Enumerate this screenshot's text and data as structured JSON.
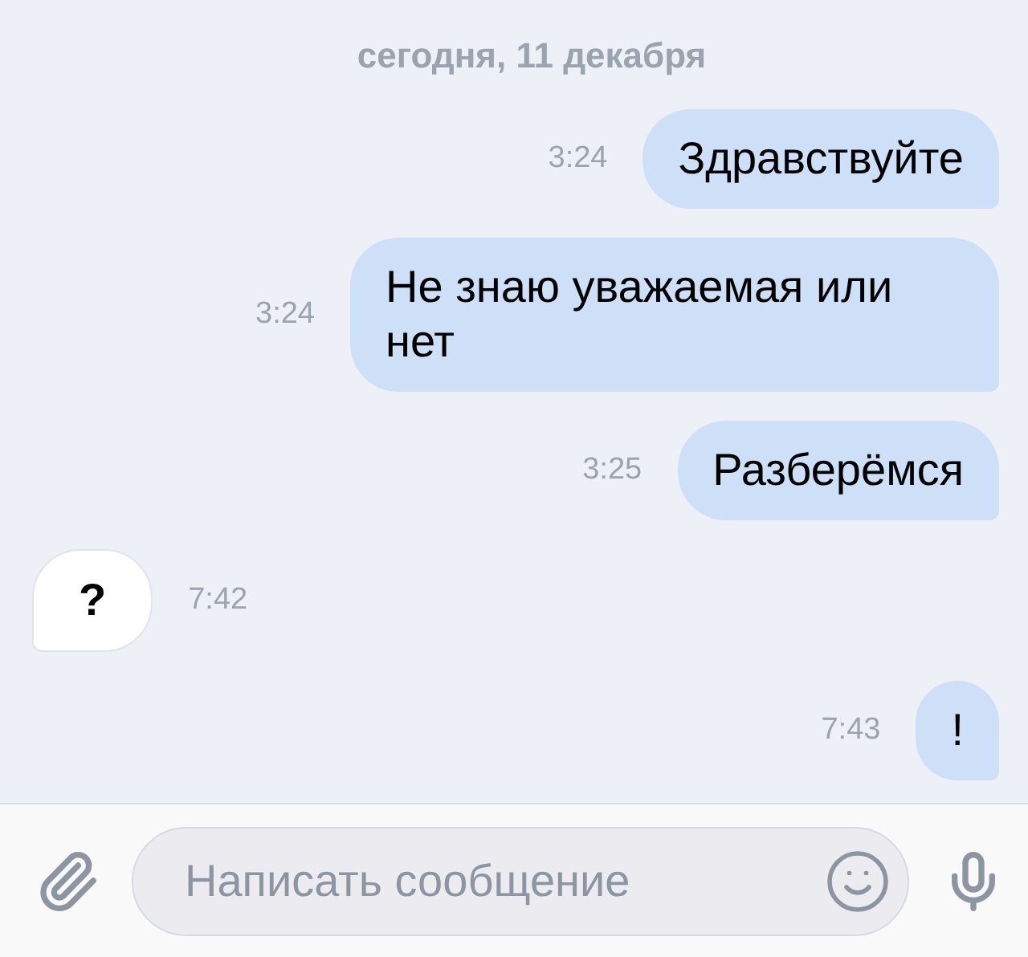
{
  "date_header": "сегодня, 11 декабря",
  "messages": [
    {
      "kind": "outgoing",
      "text": "Здравствуйте",
      "time": "3:24"
    },
    {
      "kind": "outgoing",
      "text": "Не знаю уважаемая или нет",
      "time": "3:24"
    },
    {
      "kind": "outgoing",
      "text": "Разберёмся",
      "time": "3:25"
    },
    {
      "kind": "incoming",
      "text": "?",
      "time": "7:42"
    },
    {
      "kind": "outgoing",
      "text": "!",
      "time": "7:43"
    }
  ],
  "composer": {
    "placeholder": "Написать сообщение"
  }
}
